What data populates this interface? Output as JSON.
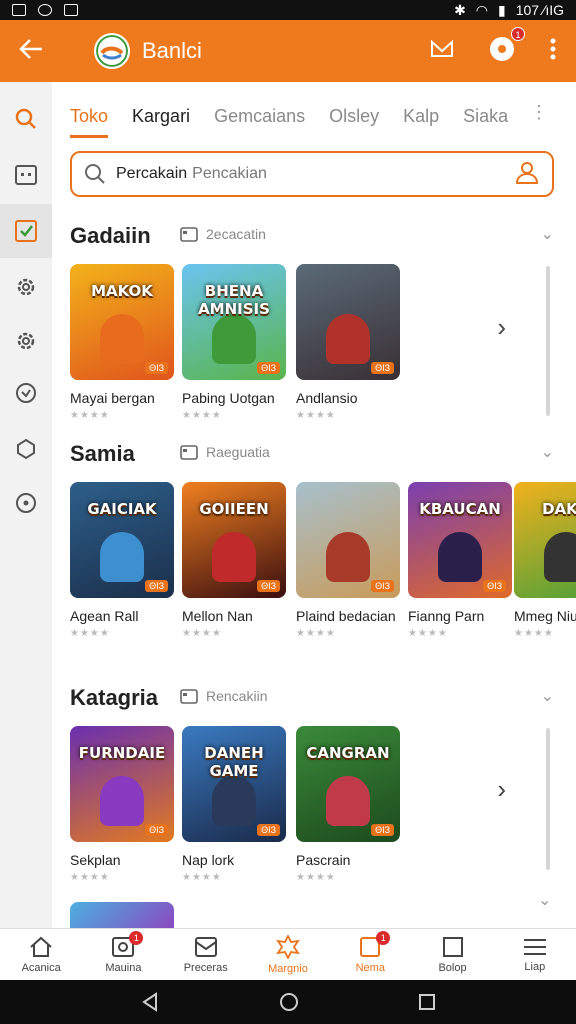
{
  "status_bar": {
    "right_text": "107 ∕ıIG"
  },
  "app_bar": {
    "title": "Banlci",
    "bell_badge": "1"
  },
  "tabs": [
    "Toko",
    "Kargari",
    "Gemcaians",
    "Olsley",
    "Kalp",
    "Siaka"
  ],
  "search": {
    "value": "Percakain",
    "placeholder": "Pencakian"
  },
  "sections": [
    {
      "title": "Gadaiin",
      "subtitle": "2ecacatin",
      "items": [
        {
          "name": "Mayai bergan",
          "art": "MAKOK",
          "colors": [
            "#f2b21a",
            "#e0551d"
          ],
          "fig": "#e86b1e"
        },
        {
          "name": "Pabing Uotgan",
          "art": "BHENA AMNISIS",
          "colors": [
            "#6ac4f0",
            "#59b44a"
          ],
          "fig": "#3f9a3a"
        },
        {
          "name": "Andlansio",
          "art": "",
          "colors": [
            "#5a6b78",
            "#3a2f35"
          ],
          "fig": "#b0322a"
        }
      ]
    },
    {
      "title": "Samia",
      "subtitle": "Raeguatia",
      "items": [
        {
          "name": "Agean Rall",
          "art": "GAICIAK",
          "colors": [
            "#2d5f8a",
            "#1b2f4b"
          ],
          "fig": "#3e8fd0"
        },
        {
          "name": "Mellon Nan",
          "art": "GOIIEEN",
          "colors": [
            "#f08020",
            "#3a0e10"
          ],
          "fig": "#c02a2a"
        },
        {
          "name": "Plaind bedacian",
          "art": "",
          "colors": [
            "#a7c0cc",
            "#c99b5a"
          ],
          "fig": "#a83a2a"
        },
        {
          "name": "Fianng Parn",
          "art": "KBAUCAN",
          "colors": [
            "#7a3fb0",
            "#e06a2a"
          ],
          "fig": "#2a1f4a"
        },
        {
          "name": "Mmeg Niu",
          "art": "DAKO",
          "colors": [
            "#f2b11c",
            "#4aa03a"
          ],
          "fig": "#333333"
        }
      ]
    },
    {
      "title": "Katagria",
      "subtitle": "Rencakiin",
      "items": [
        {
          "name": "Sekplan",
          "art": "FURNDAIE",
          "colors": [
            "#6a2fb0",
            "#e27a20"
          ],
          "fig": "#8a3ac0"
        },
        {
          "name": "Nap lork",
          "art": "DANEH GAME",
          "colors": [
            "#3a7ac0",
            "#1a2a4a"
          ],
          "fig": "#2a3a5a"
        },
        {
          "name": "Pascrain",
          "art": "CANGRAN",
          "colors": [
            "#3a8a3a",
            "#1d4a1d"
          ],
          "fig": "#c03a4a"
        }
      ]
    }
  ],
  "bottom_nav": [
    {
      "label": "Acanica",
      "icon": "home-icon"
    },
    {
      "label": "Mauina",
      "icon": "message-icon",
      "badge": "1"
    },
    {
      "label": "Preceras",
      "icon": "inbox-icon"
    },
    {
      "label": "Margnio",
      "icon": "star-badge-icon",
      "active": true
    },
    {
      "label": "Nema",
      "icon": "bookmark-icon",
      "badge": "1",
      "active": true
    },
    {
      "label": "Bolop",
      "icon": "square-icon"
    },
    {
      "label": "Liap",
      "icon": "menu-icon"
    }
  ],
  "card_tag": "ΘIЗ",
  "star_glyphs": "★★★★",
  "theme": {
    "accent": "#ef7a1e",
    "badge": "#d92b2b"
  }
}
